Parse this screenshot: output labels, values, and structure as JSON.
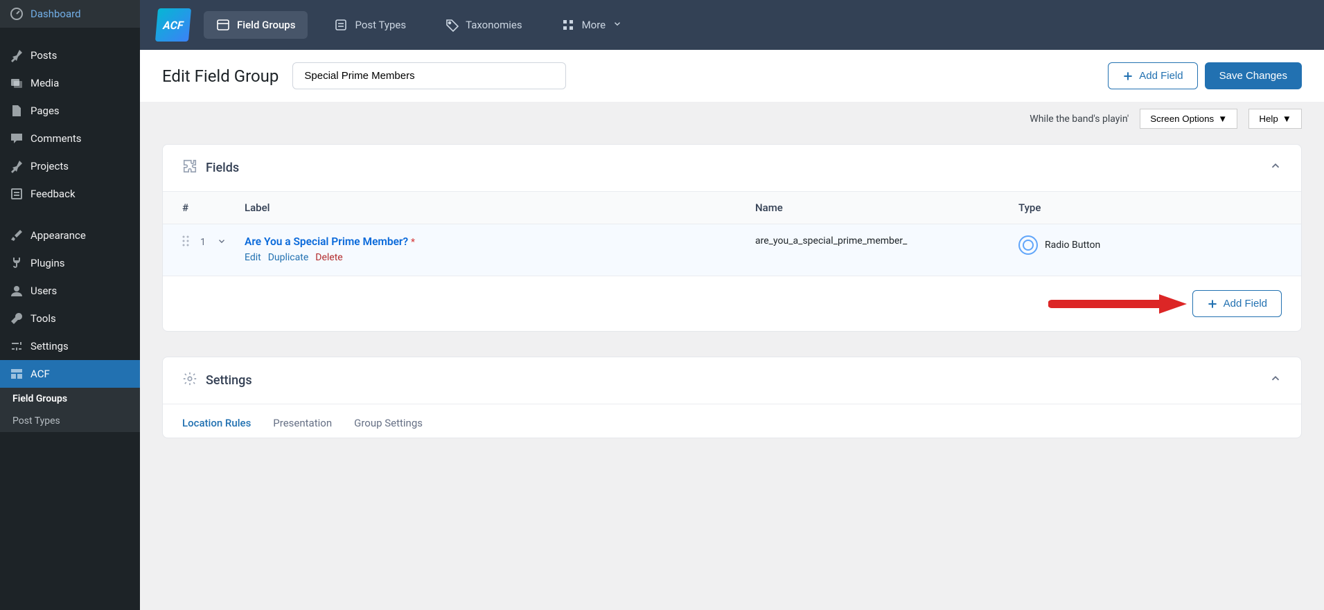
{
  "sidebar": {
    "items": [
      {
        "label": "Dashboard"
      },
      {
        "label": "Posts"
      },
      {
        "label": "Media"
      },
      {
        "label": "Pages"
      },
      {
        "label": "Comments"
      },
      {
        "label": "Projects"
      },
      {
        "label": "Feedback"
      },
      {
        "label": "Appearance"
      },
      {
        "label": "Plugins"
      },
      {
        "label": "Users"
      },
      {
        "label": "Tools"
      },
      {
        "label": "Settings"
      },
      {
        "label": "ACF"
      }
    ],
    "subitems": [
      {
        "label": "Field Groups"
      },
      {
        "label": "Post Types"
      }
    ]
  },
  "topnav": {
    "logo": "ACF",
    "items": [
      {
        "label": "Field Groups"
      },
      {
        "label": "Post Types"
      },
      {
        "label": "Taxonomies"
      },
      {
        "label": "More"
      }
    ]
  },
  "titlebar": {
    "heading": "Edit Field Group",
    "title_value": "Special Prime Members",
    "add_field": "Add Field",
    "save": "Save Changes"
  },
  "metarow": {
    "status": "While the band's playin'",
    "screen_options": "Screen Options",
    "help": "Help"
  },
  "fields_panel": {
    "title": "Fields",
    "columns": {
      "num": "#",
      "label": "Label",
      "name": "Name",
      "type": "Type"
    },
    "rows": [
      {
        "num": "1",
        "label": "Are You a Special Prime Member?",
        "required": "*",
        "name": "are_you_a_special_prime_member_",
        "type": "Radio Button",
        "actions": {
          "edit": "Edit",
          "duplicate": "Duplicate",
          "delete": "Delete"
        }
      }
    ],
    "add_field": "Add Field"
  },
  "settings_panel": {
    "title": "Settings",
    "tabs": [
      {
        "label": "Location Rules"
      },
      {
        "label": "Presentation"
      },
      {
        "label": "Group Settings"
      }
    ]
  }
}
